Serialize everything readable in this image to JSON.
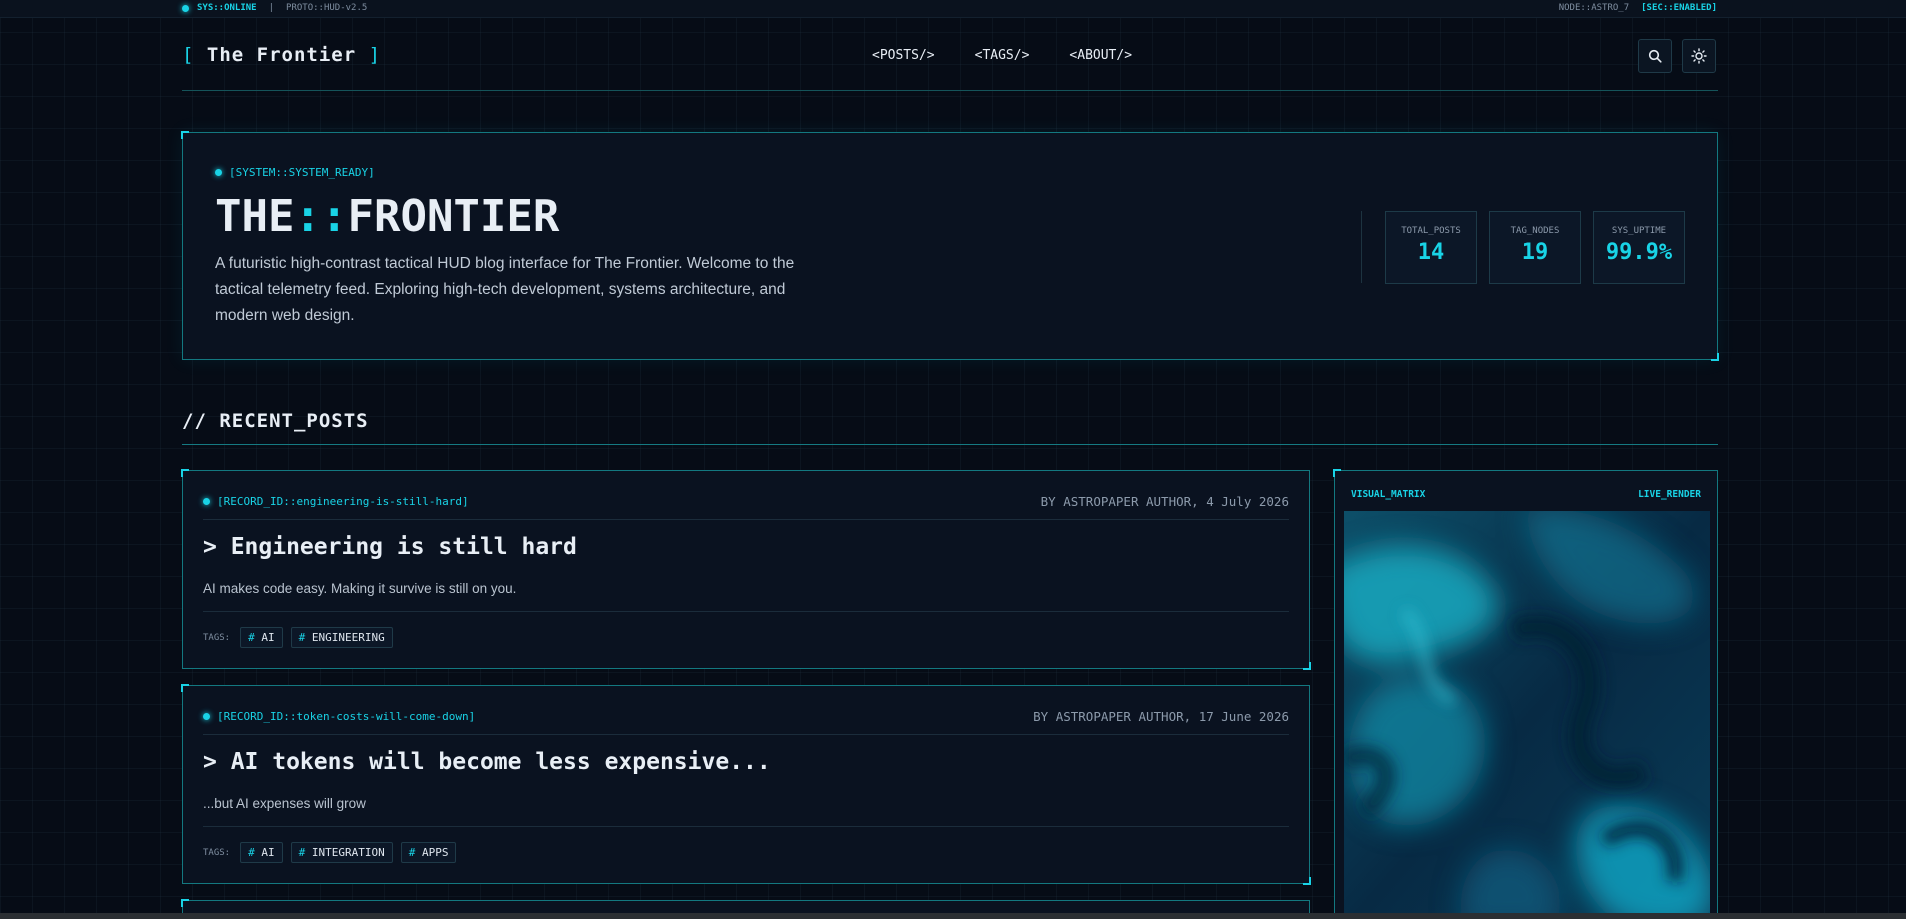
{
  "statusbar": {
    "status": "SYS::ONLINE",
    "separator": "|",
    "proto": "PROTO::HUD-v2.5",
    "node": "NODE::ASTRO_7",
    "sec": "[SEC::ENABLED]"
  },
  "header": {
    "logo_open": "[",
    "logo_text": "The Frontier",
    "logo_close": "]",
    "nav": [
      "<POSTS/>",
      "<TAGS/>",
      "<ABOUT/>"
    ],
    "search_icon": "search-icon",
    "theme_icon": "sun-icon"
  },
  "hero": {
    "system_tag": "[SYSTEM::SYSTEM_READY]",
    "title_a": "THE",
    "title_sep": "::",
    "title_b": "FRONTIER",
    "description": "A futuristic high-contrast tactical HUD blog interface for The Frontier. Welcome to the tactical telemetry feed. Exploring high-tech development, systems architecture, and modern web design.",
    "stats": [
      {
        "label": "TOTAL_POSTS",
        "value": "14"
      },
      {
        "label": "TAG_NODES",
        "value": "19"
      },
      {
        "label": "SYS_UPTIME",
        "value": "99.9%"
      }
    ]
  },
  "section": {
    "title": "// RECENT_POSTS"
  },
  "posts": [
    {
      "record": "[RECORD_ID::engineering-is-still-hard]",
      "meta": "BY ASTROPAPER AUTHOR, 4 July 2026",
      "title": "> Engineering is still hard",
      "desc": "AI makes code easy. Making it survive is still on you.",
      "tags_label": "TAGS:",
      "tags": [
        "AI",
        "ENGINEERING"
      ]
    },
    {
      "record": "[RECORD_ID::token-costs-will-come-down]",
      "meta": "BY ASTROPAPER AUTHOR, 17 June 2026",
      "title": "> AI tokens will become less expensive...",
      "desc": "...but AI expenses will grow",
      "tags_label": "TAGS:",
      "tags": [
        "AI",
        "INTEGRATION",
        "APPS"
      ]
    }
  ],
  "tag_hash": "#",
  "matrix": {
    "left_label": "VISUAL_MATRIX",
    "right_label": "LIVE_RENDER"
  },
  "colors": {
    "accent": "#19d3e6",
    "background": "#060c16",
    "panel": "#0a1220",
    "border": "#137880"
  }
}
